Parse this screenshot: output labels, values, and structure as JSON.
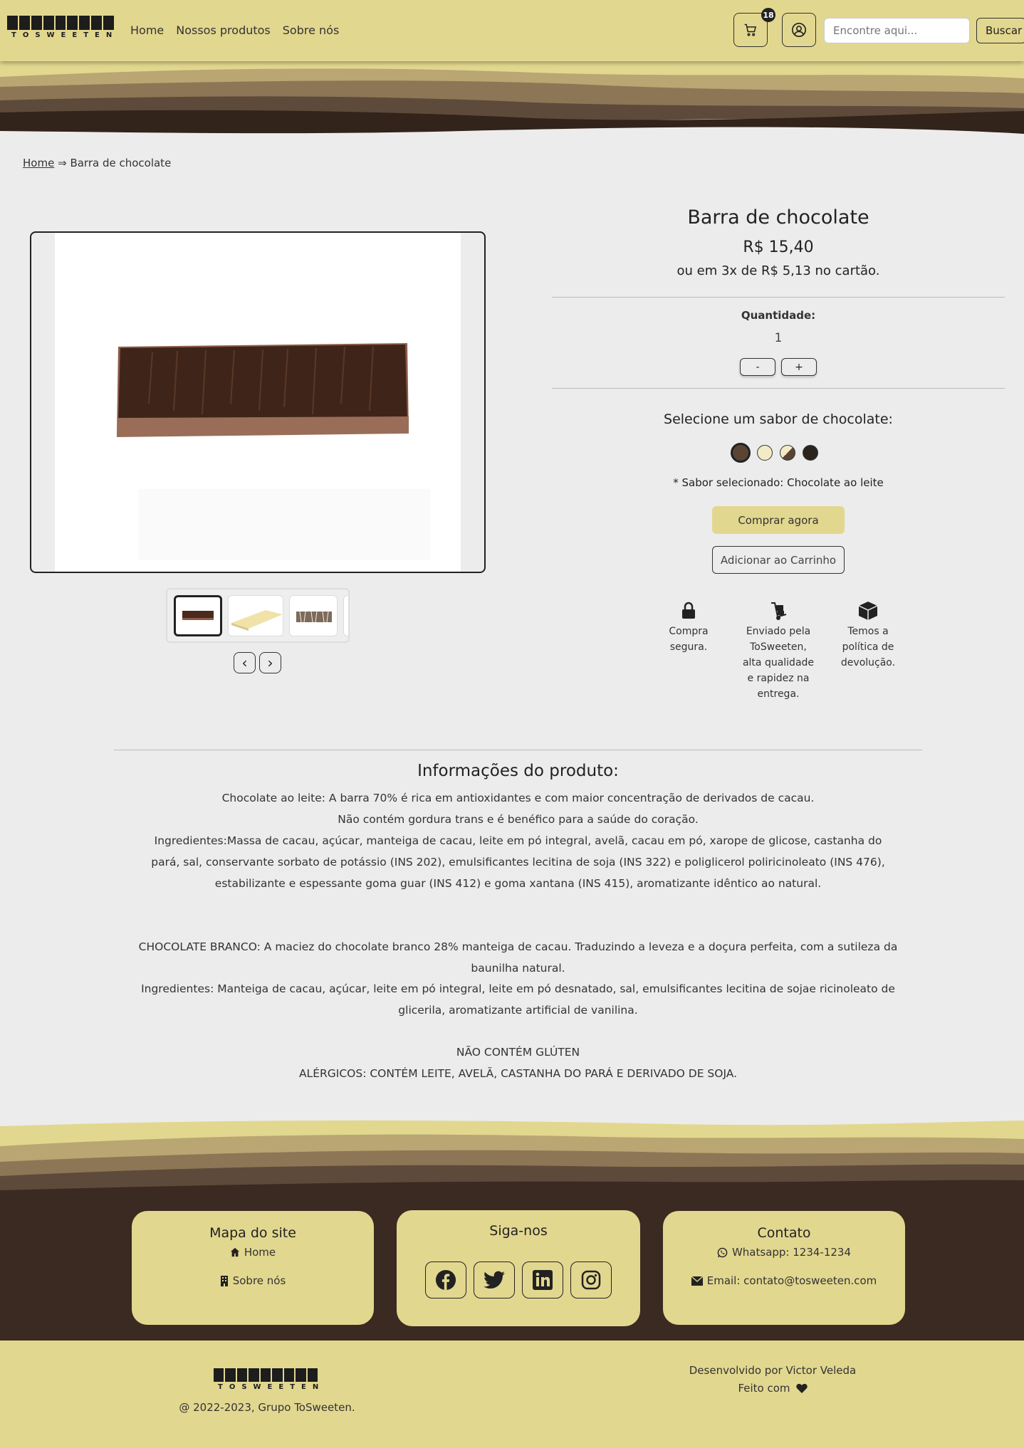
{
  "brand": {
    "logo_text": "TOSWEETEN"
  },
  "nav": {
    "home": "Home",
    "products": "Nossos produtos",
    "about": "Sobre nós"
  },
  "header": {
    "cart_count": "18",
    "search_placeholder": "Encontre aqui...",
    "search_button": "Buscar"
  },
  "breadcrumb": {
    "home": "Home",
    "separator": "⇒",
    "current": "Barra de chocolate"
  },
  "product": {
    "title": "Barra de chocolate",
    "price": "R$ 15,40",
    "installments": "ou em 3x de R$ 5,13 no cartão.",
    "quantity_label": "Quantidade:",
    "quantity": "1",
    "minus": "-",
    "plus": "+",
    "flavor_heading": "Selecione um sabor de chocolate:",
    "flavor_selected": "* Sabor selecionado: Chocolate ao leite",
    "swatch_colors": [
      "#5a4535",
      "#f3eac6",
      "#8b7660",
      "#2b241c"
    ],
    "buy_now": "Comprar agora",
    "add_to_cart": "Adicionar ao Carrinho"
  },
  "features": [
    {
      "icon": "lock-icon",
      "text": "Compra segura."
    },
    {
      "icon": "hand-truck-icon",
      "text": "Enviado pela ToSweeten, alta qualidade e rapidez na entrega."
    },
    {
      "icon": "box-icon",
      "text": "Temos a política de devolução."
    }
  ],
  "gallery": {
    "prev": "‹",
    "next": "›"
  },
  "info": {
    "title": "Informações do produto:",
    "milk_1": "Chocolate ao leite: A barra 70% é rica em antioxidantes e com maior concentração de derivados de cacau.",
    "milk_2": "Não contém gordura trans e é benéfico para a saúde do coração.",
    "milk_3": "Ingredientes:Massa de cacau, açúcar, manteiga de cacau, leite em pó integral, avelã, cacau em pó, xarope de glicose, castanha do pará, sal, conservante sorbato de potássio (INS 202), emulsificantes lecitina de soja (INS 322) e poliglicerol poliricinoleato (INS 476), estabilizante e espessante goma guar (INS 412) e goma xantana (INS 415), aromatizante idêntico ao natural.",
    "white_1": "CHOCOLATE BRANCO: A maciez do chocolate branco 28% manteiga de cacau. Traduzindo a leveza e a doçura perfeita, com a sutileza da baunilha natural.",
    "white_2": "Ingredientes: Manteiga de cacau, açúcar, leite em pó integral, leite em pó desnatado, sal, emulsificantes lecitina de sojae ricinoleato de glicerila, aromatizante artificial de vanilina.",
    "gluten": "NÃO CONTÉM GLÚTEN",
    "allergens": "ALÉRGICOS: CONTÉM LEITE, AVELÃ, CASTANHA DO PARÁ E DERIVADO DE SOJA."
  },
  "footer": {
    "sitemap_title": "Mapa do site",
    "sitemap_home": "Home",
    "sitemap_about": "Sobre nós",
    "follow_title": "Siga-nos",
    "contact_title": "Contato",
    "whatsapp": "Whatsapp: 1234-1234",
    "email": "Email: contato@tosweeten.com",
    "copyright": "@ 2022-2023, Grupo ToSweeten.",
    "developed_by": "Desenvolvido por Victor Veleda",
    "made_with": "Feito com"
  },
  "colors": {
    "header_bg": "#e2d78f",
    "footer_dark": "#3a2a21",
    "accent_brown": "#5e4a3a"
  }
}
